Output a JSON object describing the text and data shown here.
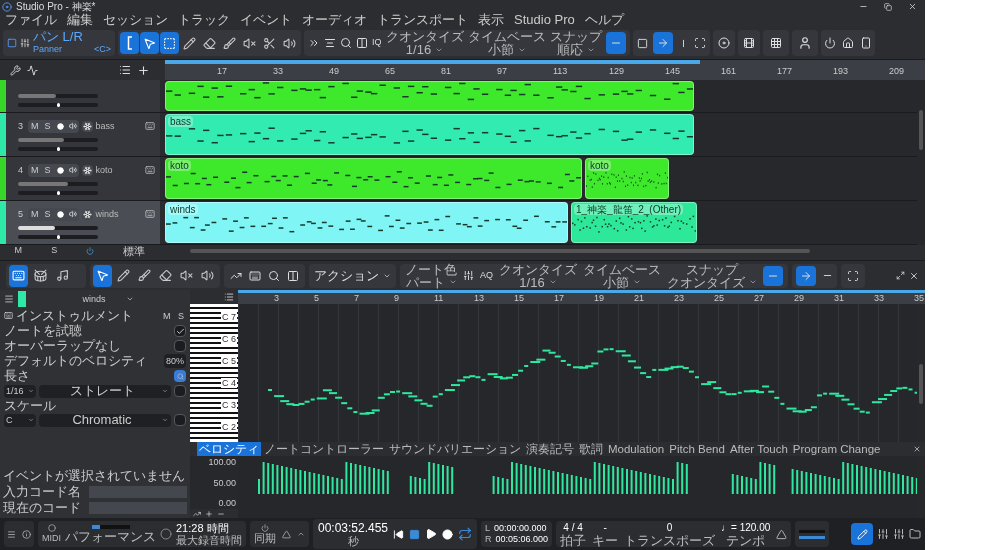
{
  "window": {
    "title": "Studio Pro - 神楽*"
  },
  "menu": [
    "ファイル",
    "編集",
    "セッション",
    "トラック",
    "イベント",
    "オーディオ",
    "トランスポート",
    "表示",
    "Studio Pro",
    "ヘルプ"
  ],
  "toolbar": {
    "mode_title": "パン L/R",
    "mode_subtitle": "Panner",
    "mode_value": "<C>",
    "tools": [
      {
        "kind": "bracket",
        "selected": true
      },
      {
        "kind": "arrow",
        "selected": true
      },
      {
        "kind": "range",
        "selected": true
      },
      {
        "kind": "pencil",
        "selected": false
      },
      {
        "kind": "eraser",
        "selected": false
      },
      {
        "kind": "paint",
        "selected": false
      },
      {
        "kind": "mute",
        "selected": false
      },
      {
        "kind": "split",
        "selected": false
      },
      {
        "kind": "listen",
        "selected": false
      }
    ],
    "quantize_label": "IQ",
    "dropdowns": [
      {
        "label": "クオンタイズ",
        "value": "1/16"
      },
      {
        "label": "タイムベース",
        "value": "小節"
      },
      {
        "label": "スナップ",
        "value": "順応"
      }
    ],
    "snap_on": true,
    "autoscroll_on": true
  },
  "arrange": {
    "ruler": [
      "17",
      "33",
      "49",
      "65",
      "81",
      "97",
      "113",
      "129",
      "145",
      "161",
      "177",
      "193",
      "209"
    ],
    "tracks": [
      {
        "color": "#39d62a",
        "selected": false,
        "volume": {
          "level": 0.47
        },
        "pan": {
          "level": 0.5
        },
        "clips": [
          {
            "color": "#3ee82a"
          }
        ]
      },
      {
        "number": "3",
        "mute": "M",
        "solo": "S",
        "name": "bass",
        "color": "#2ee8a8",
        "selected": false,
        "volume": {
          "level": 0.58
        },
        "pan": {
          "level": 0.5
        },
        "clips": [
          {
            "label": "bass",
            "color": "#32ebb0"
          }
        ]
      },
      {
        "number": "4",
        "mute": "M",
        "solo": "S",
        "name": "koto",
        "color": "#39d62a",
        "selected": false,
        "volume": {
          "level": 0.63
        },
        "pan": {
          "level": 0.5
        },
        "clips": [
          {
            "label": "koto",
            "color": "#3ee82a"
          },
          {
            "label": "koto",
            "color": "#3ee82a"
          }
        ]
      },
      {
        "number": "5",
        "mute": "M",
        "solo": "S",
        "name": "winds",
        "color": "#2ee8a8",
        "selected": true,
        "volume": {
          "level": 0.46
        },
        "pan": {
          "level": 0.5
        },
        "clips": [
          {
            "label": "winds",
            "color": "#7ff5f5"
          },
          {
            "label": "1_神楽_龍笛_2_(Other)",
            "color": "#2ee89a"
          }
        ]
      }
    ],
    "footer": {
      "mute": "M",
      "solo": "S",
      "layout": "標準"
    }
  },
  "editor": {
    "track_name": "winds",
    "view_tabs": [
      {
        "kind": "piano",
        "selected": true
      },
      {
        "kind": "drum",
        "selected": false
      },
      {
        "kind": "score",
        "selected": false
      }
    ],
    "tools": [
      {
        "kind": "arrow",
        "selected": true
      },
      {
        "kind": "pencil",
        "selected": false
      },
      {
        "kind": "paint",
        "selected": false
      },
      {
        "kind": "eraser",
        "selected": false
      },
      {
        "kind": "mute",
        "selected": false
      },
      {
        "kind": "listen",
        "selected": false
      }
    ],
    "action": "アクション",
    "aq": "AQ",
    "dropdowns": [
      {
        "label": "ノート色",
        "value": "パート"
      },
      {
        "label": "クオンタイズ",
        "value": "1/16"
      },
      {
        "label": "タイムベース",
        "value": "小節"
      },
      {
        "label": "スナップ",
        "value": "クオンタイズ"
      }
    ],
    "snap_on": true,
    "autoscroll_on": true,
    "ruler": [
      "3",
      "5",
      "7",
      "9",
      "11",
      "13",
      "15",
      "17",
      "19",
      "21",
      "23",
      "25",
      "27",
      "29",
      "31",
      "33",
      "35"
    ],
    "keys": [
      "C 7",
      "C 6",
      "C 5",
      "C 4",
      "C 3",
      "C 2"
    ],
    "lanes": [
      {
        "label": "ベロシティ",
        "selected": true
      },
      {
        "label": "ノートコントローラー",
        "selected": false
      },
      {
        "label": "サウンドバリエーション",
        "selected": false
      },
      {
        "label": "演奏記号",
        "selected": false
      },
      {
        "label": "歌詞",
        "selected": false
      },
      {
        "label": "Modulation",
        "selected": false
      },
      {
        "label": "Pitch Bend",
        "selected": false
      },
      {
        "label": "After Touch",
        "selected": false
      },
      {
        "label": "Program Change",
        "selected": false
      }
    ],
    "lane_ticks": [
      "100.00",
      "50.00",
      "0.00"
    ]
  },
  "inspector": {
    "instrument": "インストゥルメント",
    "mute": "M",
    "solo": "S",
    "rows": [
      {
        "kind": "check",
        "label": "ノートを試聴",
        "checked": true
      },
      {
        "kind": "check",
        "label": "オーバーラップなし",
        "checked": false
      },
      {
        "kind": "value",
        "label": "デフォルトのベロシティ",
        "value": "80%"
      },
      {
        "kind": "toggle",
        "label": "長さ",
        "on": true
      },
      {
        "kind": "selects",
        "values": [
          "1/16",
          "ストレート"
        ]
      },
      {
        "kind": "heading",
        "label": "スケール"
      },
      {
        "kind": "selects",
        "values": [
          "C",
          "Chromatic"
        ]
      }
    ],
    "status": "イベントが選択されていません",
    "chord_input": "入力コード名",
    "chord_current": "現在のコード"
  },
  "transport": {
    "midi": "MIDI",
    "performance": "パフォーマンス",
    "record_time": "21:28 時間",
    "record_label": "最大録音時間",
    "sync": "同期",
    "time": "00:03:52.455",
    "time_unit": "秒",
    "left": "L",
    "left_time": "00:00:00.000",
    "right": "R",
    "right_time": "00:05:06.000",
    "signature": "4 / 4",
    "signature_label": "拍子",
    "key": "-",
    "key_label": "キー",
    "transpose": "0",
    "transpose_label": "トランスポーズ",
    "tempo": "♩= 120.00",
    "tempo_label": "テンポ",
    "loop_on": true
  }
}
